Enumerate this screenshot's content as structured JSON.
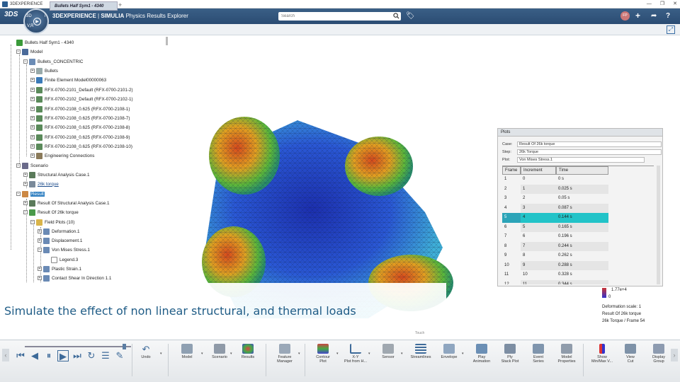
{
  "window": {
    "title": "3DEXPERIENCE"
  },
  "app": {
    "brand_bold": "3DEXPERIENCE",
    "brand_sep": " | ",
    "brand_simulia": "SIMULIA",
    "brand_rest": " Physics Results Explorer"
  },
  "compass": {
    "n1": "3D",
    "n2": "i",
    "n3": "V,R",
    "n4": "▶"
  },
  "search": {
    "placeholder": "Search"
  },
  "user": {
    "initials": "FP"
  },
  "tabs": {
    "active": "Bullets Half Sym1 - 4340"
  },
  "tree": {
    "root": "Bullets Half Sym1 - 4340",
    "model": "Model",
    "concentric": "Bullets_CONCENTRIC",
    "bullets": "Bullets",
    "fem": "Finite Element Model00000063",
    "r1": "RFX-0700-2101_Default (RFX-0700-2101-2)",
    "r2": "RFX-0700-2102_Default (RFX-0700-2102-1)",
    "r3": "RFX-0700-2108_0.625 (RFX-0700-2108-1)",
    "r4": "RFX-0700-2108_0.625 (RFX-0700-2108-7)",
    "r5": "RFX-0700-2108_0.625 (RFX-0700-2108-8)",
    "r6": "RFX-0700-2108_0.625 (RFX-0700-2108-9)",
    "r7": "RFX-0700-2108_0.625 (RFX-0700-2108-10)",
    "eng": "Engineering Connections",
    "scenario": "Scenario",
    "sac": "Structural Analysis Case.1",
    "torque": "26k torque",
    "result": "Result",
    "rosac": "Result Of Structural Analysis Case.1",
    "ro26": "Result Of 26k torque",
    "fp": "Field Plots (10)",
    "def": "Deformation.1",
    "disp": "Displacement.1",
    "vm": "Von Mises Stress.1",
    "leg": "Legend.3",
    "ps": "Plastic Strain.1",
    "cs": "Contact Shear In Direction 1.1"
  },
  "plots": {
    "title": "Plots",
    "case_label": "Case:",
    "case_value": "Result Of 26k torque",
    "step_label": "Step:",
    "step_value": "26k Torque",
    "plot_label": "Plot:",
    "plot_value": "Von Mises Stress.1",
    "headers": [
      "Frame",
      "Increment",
      "Time"
    ],
    "rows": [
      [
        "1",
        "0",
        "0 s"
      ],
      [
        "2",
        "1",
        "0.025 s"
      ],
      [
        "3",
        "2",
        "0.05 s"
      ],
      [
        "4",
        "3",
        "0.087 s"
      ],
      [
        "5",
        "4",
        "0.144 s"
      ],
      [
        "6",
        "5",
        "0.165 s"
      ],
      [
        "7",
        "6",
        "0.196 s"
      ],
      [
        "8",
        "7",
        "0.244 s"
      ],
      [
        "9",
        "8",
        "0.262 s"
      ],
      [
        "10",
        "9",
        "0.288 s"
      ],
      [
        "11",
        "10",
        "0.328 s"
      ],
      [
        "12",
        "11",
        "0.344 s"
      ]
    ],
    "selected_frame": "5"
  },
  "legend": {
    "max": "1.77e+4",
    "min": "0"
  },
  "info": {
    "line1": "Deformation scale: 1",
    "line2": "Result Of 26k torque",
    "line3": "26k Torque / Frame 54"
  },
  "banner": {
    "text": "Simulate the effect of non linear structural, and thermal loads"
  },
  "modes": {
    "m1": "Touch"
  },
  "colors": {
    "accent": "#22c3c8",
    "topbar": "#2b4c73",
    "banner_text": "#1f5c86"
  },
  "toolbar": {
    "undo": "Undo",
    "model": "Model",
    "scenario": "Scenario",
    "results": "Results",
    "feature_manager": "Feature\nManager",
    "contour": "Contour\nPlot",
    "xy": "X-Y\nPlot from H...",
    "sensor": "Sensor",
    "streamlines": "Streamlines",
    "envelope": "Envelope",
    "play": "Play\nAnimation",
    "plyplot": "Ply\nStack Plot",
    "events": "Event\nSeries",
    "modelprops": "Model\nProperties",
    "minmax": "Show\nMin/Max V...",
    "viewcut": "View\nCut",
    "dispgroup": "Display\nGroup"
  }
}
